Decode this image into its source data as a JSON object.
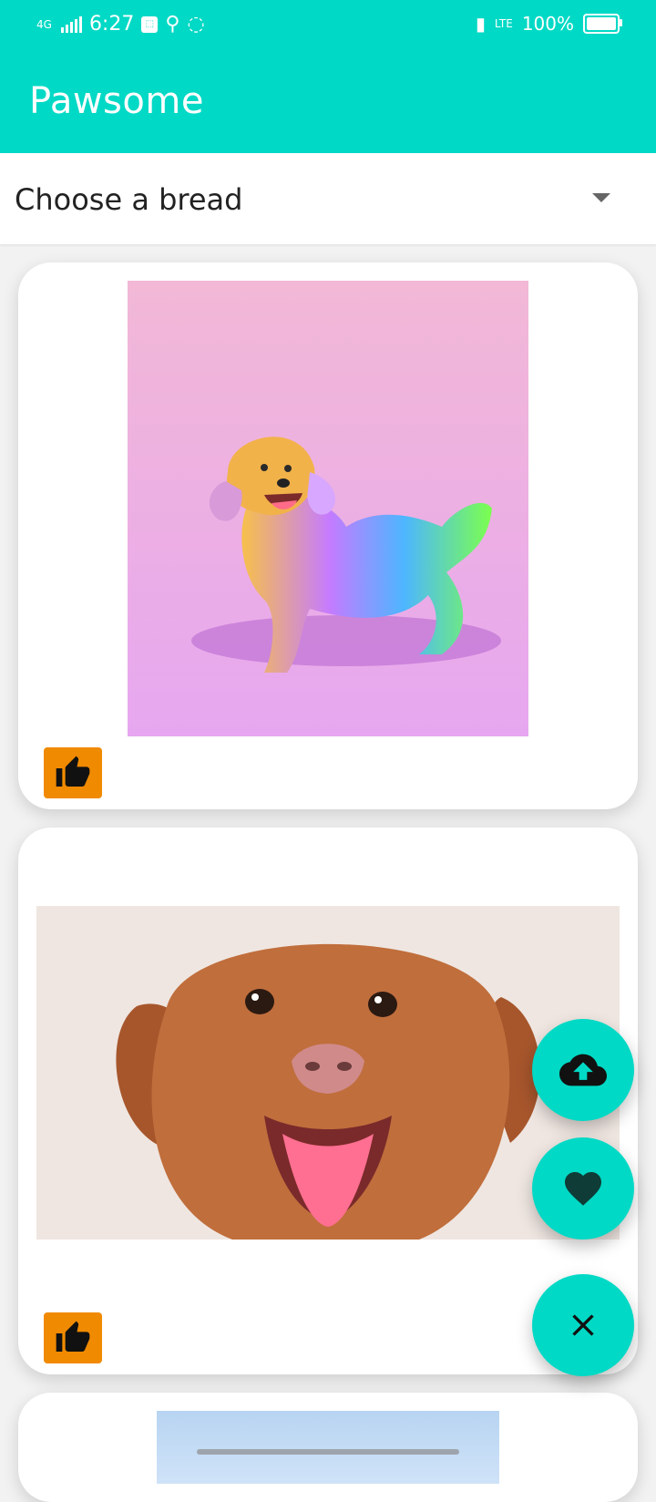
{
  "status": {
    "network": "4G",
    "time": "6:27",
    "battery": "100%",
    "volte": "LTE"
  },
  "app": {
    "title": "Pawsome"
  },
  "breed_select": {
    "placeholder": "Choose a bread"
  },
  "cards": [
    {
      "image_desc": "rainbow-puppy",
      "like_icon": "thumbs-up-icon"
    },
    {
      "image_desc": "brown-dog",
      "like_icon": "thumbs-up-icon"
    },
    {
      "image_desc": "sky"
    }
  ],
  "fab": {
    "upload_icon": "cloud-upload-icon",
    "favorite_icon": "heart-icon",
    "close_icon": "close-icon"
  },
  "colors": {
    "accent": "#00d9c5",
    "like_button": "#f08a00"
  }
}
